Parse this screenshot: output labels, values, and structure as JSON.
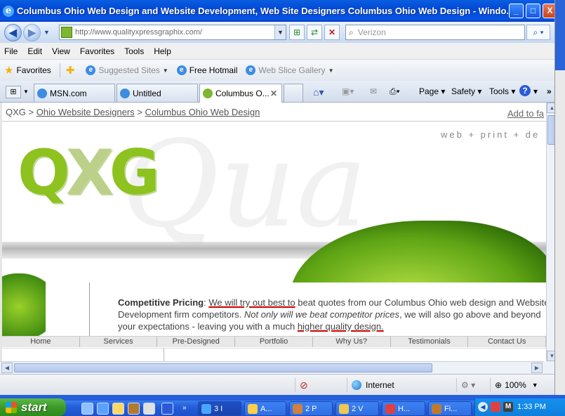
{
  "window": {
    "title": "Columbus Ohio Web Design and Website Development, Web Site Designers Columbus Ohio Web Design - Windo...",
    "minimize": "_",
    "maximize": "□",
    "close": "X"
  },
  "address_bar": {
    "url": "http://www.qualityxpressgraphix.com/",
    "search_placeholder": "Verizon"
  },
  "menu": [
    "File",
    "Edit",
    "View",
    "Favorites",
    "Tools",
    "Help"
  ],
  "favorites_bar": {
    "favorites_label": "Favorites",
    "items": [
      "Suggested Sites",
      "Free Hotmail",
      "Web Slice Gallery"
    ]
  },
  "tabs": [
    {
      "label": "MSN.com"
    },
    {
      "label": "Untitled"
    },
    {
      "label": "Columbus O..."
    }
  ],
  "commands": {
    "page": "Page",
    "safety": "Safety",
    "tools": "Tools",
    "help": "?"
  },
  "page": {
    "breadcrumb_root": "QXG",
    "breadcrumb_sep": ">",
    "breadcrumb_1": "Ohio Website Designers",
    "breadcrumb_2": "Columbus Ohio Web Design",
    "add_to": "Add to fa",
    "tagline": "web + print + de",
    "logo_q": "Q",
    "logo_x": "X",
    "logo_g": "G",
    "para_lead": "Competitive Pricing",
    "para_colon": ": ",
    "para_u1": "We will try out best to",
    "para_t1": " beat quotes from our Columbus Ohio web design and Website Development firm competitors. ",
    "para_italic": "Not only will we beat competitor prices",
    "para_t2": ", we will also go above and beyond your expectations - leaving you with a much ",
    "para_u2": "higher quality design.",
    "nav": [
      "Home",
      "Services",
      "Pre-Designed",
      "Portfolio",
      "Why Us?",
      "Testimonials",
      "Contact Us"
    ]
  },
  "status_bar": {
    "zone": "Internet",
    "zoom": "100%"
  },
  "taskbar": {
    "start": "start",
    "tasks": [
      "3 I",
      "A...",
      "2 P",
      "2 V",
      "H...",
      "Fi..."
    ],
    "clock": "1:33 PM"
  }
}
